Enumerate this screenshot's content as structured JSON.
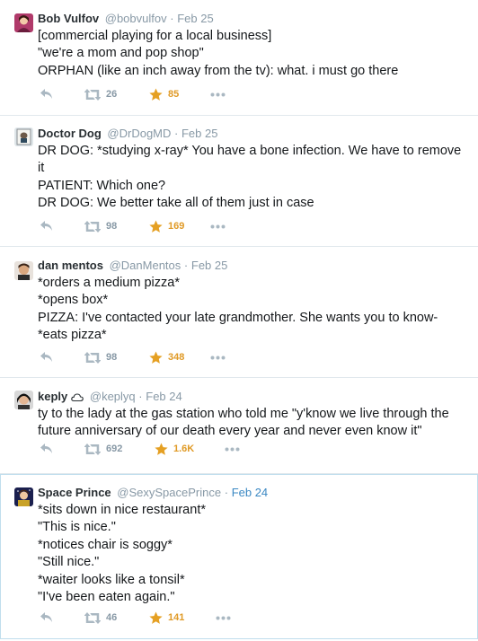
{
  "tweets": [
    {
      "name": "Bob Vulfov",
      "handle": "@bobvulfov",
      "sep": "·",
      "date": "Feb 25",
      "lines": [
        "[commercial playing for a local business]",
        "\"we're a mom and pop shop\"",
        "ORPHAN (like an inch away from the tv): what. i must go there"
      ],
      "retweets": "26",
      "favorites": "85"
    },
    {
      "name": "Doctor Dog",
      "handle": "@DrDogMD",
      "sep": "·",
      "date": "Feb 25",
      "lines": [
        "DR DOG: *studying x-ray* You have a bone infection. We have to remove it",
        "PATIENT: Which one?",
        "DR DOG: We better take all of them just in case"
      ],
      "retweets": "98",
      "favorites": "169"
    },
    {
      "name": "dan mentos",
      "handle": "@DanMentos",
      "sep": "·",
      "date": "Feb 25",
      "lines": [
        "*orders a medium pizza*",
        "*opens box*",
        "PIZZA: I've contacted your late grandmother. She wants you to know-",
        "*eats pizza*"
      ],
      "retweets": "98",
      "favorites": "348"
    },
    {
      "name": "keply",
      "handle": "@keplyq",
      "sep": "·",
      "date": "Feb 24",
      "lines": [
        "ty to the lady at the gas station who told me \"y'know we live through the future anniversary of our death every year and never even know it\""
      ],
      "retweets": "692",
      "favorites": "1.6K"
    },
    {
      "name": "Space Prince",
      "handle": "@SexySpacePrince",
      "sep": "·",
      "date": "Feb 24",
      "lines": [
        "*sits down in nice restaurant*",
        "\"This is nice.\"",
        "*notices chair is soggy*",
        "\"Still nice.\"",
        "*waiter looks like a tonsil*",
        "\"I've been eaten again.\""
      ],
      "retweets": "46",
      "favorites": "141"
    }
  ],
  "colors": {
    "name": "#292f33",
    "muted": "#8899a6",
    "favorite": "#e09a26",
    "highlight_border": "#c0deed",
    "date_highlight": "#3b88c3"
  }
}
